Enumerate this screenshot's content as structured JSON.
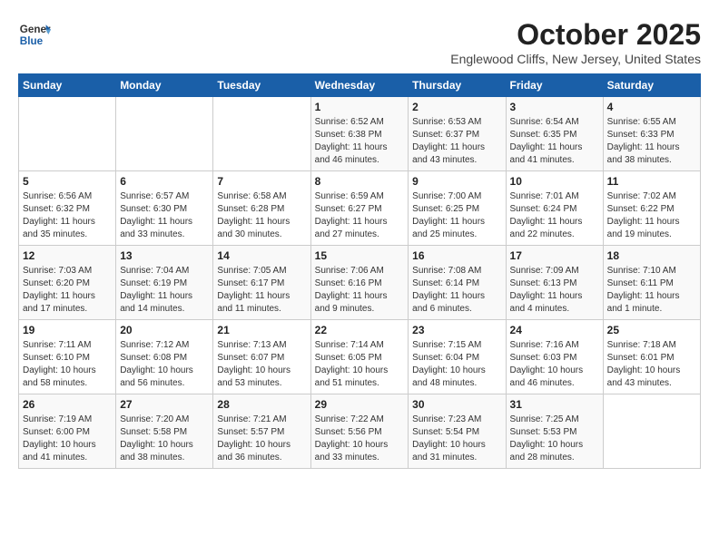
{
  "header": {
    "logo_line1": "General",
    "logo_line2": "Blue",
    "month": "October 2025",
    "location": "Englewood Cliffs, New Jersey, United States"
  },
  "days_of_week": [
    "Sunday",
    "Monday",
    "Tuesday",
    "Wednesday",
    "Thursday",
    "Friday",
    "Saturday"
  ],
  "weeks": [
    [
      {
        "day": "",
        "info": ""
      },
      {
        "day": "",
        "info": ""
      },
      {
        "day": "",
        "info": ""
      },
      {
        "day": "1",
        "info": "Sunrise: 6:52 AM\nSunset: 6:38 PM\nDaylight: 11 hours and 46 minutes."
      },
      {
        "day": "2",
        "info": "Sunrise: 6:53 AM\nSunset: 6:37 PM\nDaylight: 11 hours and 43 minutes."
      },
      {
        "day": "3",
        "info": "Sunrise: 6:54 AM\nSunset: 6:35 PM\nDaylight: 11 hours and 41 minutes."
      },
      {
        "day": "4",
        "info": "Sunrise: 6:55 AM\nSunset: 6:33 PM\nDaylight: 11 hours and 38 minutes."
      }
    ],
    [
      {
        "day": "5",
        "info": "Sunrise: 6:56 AM\nSunset: 6:32 PM\nDaylight: 11 hours and 35 minutes."
      },
      {
        "day": "6",
        "info": "Sunrise: 6:57 AM\nSunset: 6:30 PM\nDaylight: 11 hours and 33 minutes."
      },
      {
        "day": "7",
        "info": "Sunrise: 6:58 AM\nSunset: 6:28 PM\nDaylight: 11 hours and 30 minutes."
      },
      {
        "day": "8",
        "info": "Sunrise: 6:59 AM\nSunset: 6:27 PM\nDaylight: 11 hours and 27 minutes."
      },
      {
        "day": "9",
        "info": "Sunrise: 7:00 AM\nSunset: 6:25 PM\nDaylight: 11 hours and 25 minutes."
      },
      {
        "day": "10",
        "info": "Sunrise: 7:01 AM\nSunset: 6:24 PM\nDaylight: 11 hours and 22 minutes."
      },
      {
        "day": "11",
        "info": "Sunrise: 7:02 AM\nSunset: 6:22 PM\nDaylight: 11 hours and 19 minutes."
      }
    ],
    [
      {
        "day": "12",
        "info": "Sunrise: 7:03 AM\nSunset: 6:20 PM\nDaylight: 11 hours and 17 minutes."
      },
      {
        "day": "13",
        "info": "Sunrise: 7:04 AM\nSunset: 6:19 PM\nDaylight: 11 hours and 14 minutes."
      },
      {
        "day": "14",
        "info": "Sunrise: 7:05 AM\nSunset: 6:17 PM\nDaylight: 11 hours and 11 minutes."
      },
      {
        "day": "15",
        "info": "Sunrise: 7:06 AM\nSunset: 6:16 PM\nDaylight: 11 hours and 9 minutes."
      },
      {
        "day": "16",
        "info": "Sunrise: 7:08 AM\nSunset: 6:14 PM\nDaylight: 11 hours and 6 minutes."
      },
      {
        "day": "17",
        "info": "Sunrise: 7:09 AM\nSunset: 6:13 PM\nDaylight: 11 hours and 4 minutes."
      },
      {
        "day": "18",
        "info": "Sunrise: 7:10 AM\nSunset: 6:11 PM\nDaylight: 11 hours and 1 minute."
      }
    ],
    [
      {
        "day": "19",
        "info": "Sunrise: 7:11 AM\nSunset: 6:10 PM\nDaylight: 10 hours and 58 minutes."
      },
      {
        "day": "20",
        "info": "Sunrise: 7:12 AM\nSunset: 6:08 PM\nDaylight: 10 hours and 56 minutes."
      },
      {
        "day": "21",
        "info": "Sunrise: 7:13 AM\nSunset: 6:07 PM\nDaylight: 10 hours and 53 minutes."
      },
      {
        "day": "22",
        "info": "Sunrise: 7:14 AM\nSunset: 6:05 PM\nDaylight: 10 hours and 51 minutes."
      },
      {
        "day": "23",
        "info": "Sunrise: 7:15 AM\nSunset: 6:04 PM\nDaylight: 10 hours and 48 minutes."
      },
      {
        "day": "24",
        "info": "Sunrise: 7:16 AM\nSunset: 6:03 PM\nDaylight: 10 hours and 46 minutes."
      },
      {
        "day": "25",
        "info": "Sunrise: 7:18 AM\nSunset: 6:01 PM\nDaylight: 10 hours and 43 minutes."
      }
    ],
    [
      {
        "day": "26",
        "info": "Sunrise: 7:19 AM\nSunset: 6:00 PM\nDaylight: 10 hours and 41 minutes."
      },
      {
        "day": "27",
        "info": "Sunrise: 7:20 AM\nSunset: 5:58 PM\nDaylight: 10 hours and 38 minutes."
      },
      {
        "day": "28",
        "info": "Sunrise: 7:21 AM\nSunset: 5:57 PM\nDaylight: 10 hours and 36 minutes."
      },
      {
        "day": "29",
        "info": "Sunrise: 7:22 AM\nSunset: 5:56 PM\nDaylight: 10 hours and 33 minutes."
      },
      {
        "day": "30",
        "info": "Sunrise: 7:23 AM\nSunset: 5:54 PM\nDaylight: 10 hours and 31 minutes."
      },
      {
        "day": "31",
        "info": "Sunrise: 7:25 AM\nSunset: 5:53 PM\nDaylight: 10 hours and 28 minutes."
      },
      {
        "day": "",
        "info": ""
      }
    ]
  ]
}
